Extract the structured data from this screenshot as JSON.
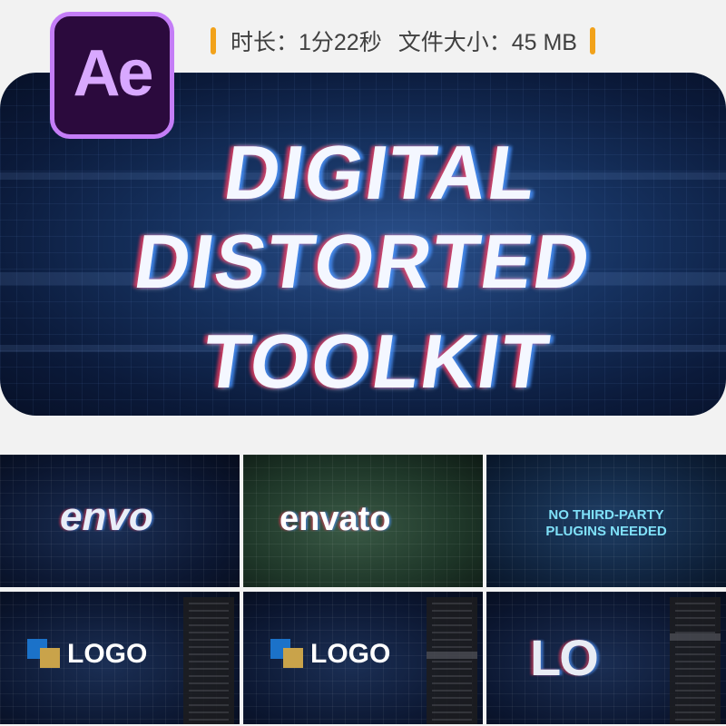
{
  "badge": {
    "text": "Ae",
    "color": "#c47df7"
  },
  "info": {
    "duration": "时长：1分22秒",
    "filesize": "文件大小：45 MB",
    "accent": "#f2a21a"
  },
  "hero": {
    "lines": [
      "DIGITAL",
      "DISTORTED",
      "TOOLKIT"
    ]
  },
  "thumbs": {
    "t1": {
      "text": "envo"
    },
    "t2": {
      "text": "envato"
    },
    "t3": {
      "line1": "NO THIRD-PARTY",
      "line2": "PLUGINS NEEDED"
    },
    "t4": {
      "text": "LOGO"
    },
    "t5": {
      "text": "LOGO"
    },
    "t6": {
      "text": "LO"
    }
  }
}
